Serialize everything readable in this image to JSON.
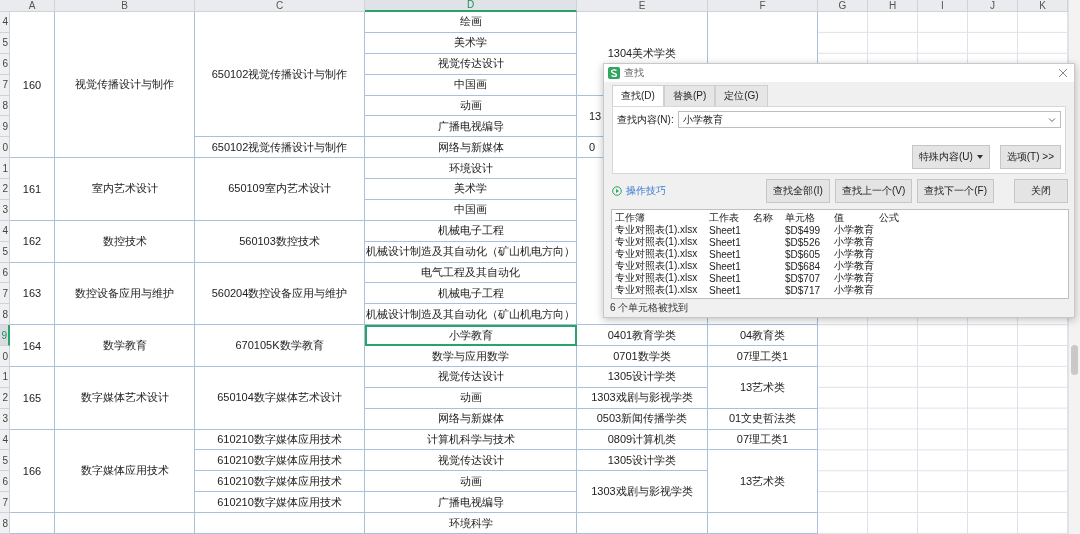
{
  "sheet": {
    "columns": [
      {
        "label": "A",
        "selected": false
      },
      {
        "label": "B",
        "selected": false
      },
      {
        "label": "C",
        "selected": false
      },
      {
        "label": "D",
        "selected": true
      },
      {
        "label": "E",
        "selected": false
      },
      {
        "label": "F",
        "selected": false
      },
      {
        "label": "G",
        "selected": false
      },
      {
        "label": "H",
        "selected": false
      },
      {
        "label": "I",
        "selected": false
      },
      {
        "label": "J",
        "selected": false
      },
      {
        "label": "K",
        "selected": false
      }
    ],
    "rows": [
      {
        "number": "4",
        "selected": false,
        "a": {
          "text": "160"
        },
        "b": {
          "text": "视觉传播设计与制作"
        },
        "c": {
          "text": "650102视觉传播设计与制作"
        },
        "d": {
          "text": "绘画"
        },
        "e": {
          "text": "1304美术学类"
        },
        "f": {
          "kind": "blank"
        }
      },
      {
        "number": "5",
        "selected": false,
        "d": {
          "text": "美术学"
        }
      },
      {
        "number": "6",
        "selected": false,
        "d": {
          "text": "视觉传达设计"
        }
      },
      {
        "number": "7",
        "selected": false,
        "d": {
          "text": "中国画"
        }
      },
      {
        "number": "8",
        "selected": false,
        "d": {
          "text": "动画"
        },
        "e": {
          "text": "13",
          "kind": "cut"
        }
      },
      {
        "number": "9",
        "selected": false,
        "d": {
          "text": "广播电视编导"
        }
      },
      {
        "number": "0",
        "selected": false,
        "c": {
          "text": "650102视觉传播设计与制作"
        },
        "d": {
          "text": "网络与新媒体"
        },
        "e": {
          "text": "0",
          "kind": "cut"
        }
      },
      {
        "number": "1",
        "selected": false,
        "a": {
          "text": "161"
        },
        "b": {
          "text": "室内艺术设计"
        },
        "c": {
          "text": "650109室内艺术设计"
        },
        "d": {
          "text": "环境设计"
        },
        "e": {
          "kind": "blank"
        }
      },
      {
        "number": "2",
        "selected": false,
        "d": {
          "text": "美术学"
        }
      },
      {
        "number": "3",
        "selected": false,
        "d": {
          "text": "中国画"
        }
      },
      {
        "number": "4",
        "selected": false,
        "a": {
          "text": "162"
        },
        "b": {
          "text": "数控技术"
        },
        "c": {
          "text": "560103数控技术"
        },
        "d": {
          "text": "机械电子工程"
        }
      },
      {
        "number": "5",
        "selected": false,
        "d": {
          "text": "机械设计制造及其自动化（矿山机电方向）"
        }
      },
      {
        "number": "6",
        "selected": false,
        "a": {
          "text": "163"
        },
        "b": {
          "text": "数控设备应用与维护"
        },
        "c": {
          "text": "560204数控设备应用与维护"
        },
        "d": {
          "text": "电气工程及其自动化"
        }
      },
      {
        "number": "7",
        "selected": false,
        "d": {
          "text": "机械电子工程"
        }
      },
      {
        "number": "8",
        "selected": false,
        "d": {
          "text": "机械设计制造及其自动化（矿山机电方向）"
        }
      },
      {
        "number": "9",
        "selected": true,
        "a": {
          "text": "164"
        },
        "b": {
          "text": "数学教育"
        },
        "c": {
          "text": "670105K数学教育"
        },
        "d": {
          "text": "小学教育"
        },
        "e": {
          "text": "0401教育学类"
        },
        "f": {
          "text": "04教育类"
        }
      },
      {
        "number": "0",
        "selected": false,
        "d": {
          "text": "数学与应用数学"
        },
        "e": {
          "text": "0701数学类"
        },
        "f": {
          "text": "07理工类1"
        }
      },
      {
        "number": "1",
        "selected": false,
        "a": {
          "text": "165"
        },
        "b": {
          "text": "数字媒体艺术设计"
        },
        "c": {
          "text": "650104数字媒体艺术设计"
        },
        "d": {
          "text": "视觉传达设计"
        },
        "e": {
          "text": "1305设计学类"
        },
        "f": {
          "text": "13艺术类"
        }
      },
      {
        "number": "2",
        "selected": false,
        "d": {
          "text": "动画"
        },
        "e": {
          "text": "1303戏剧与影视学类"
        }
      },
      {
        "number": "3",
        "selected": false,
        "d": {
          "text": "网络与新媒体"
        },
        "e": {
          "text": "0503新闻传播学类"
        },
        "f": {
          "text": "01文史哲法类"
        }
      },
      {
        "number": "4",
        "selected": false,
        "a": {
          "text": "166"
        },
        "b": {
          "text": "数字媒体应用技术"
        },
        "c": {
          "text": "610210数字媒体应用技术"
        },
        "d": {
          "text": "计算机科学与技术"
        },
        "e": {
          "text": "0809计算机类"
        },
        "f": {
          "text": "07理工类1"
        }
      },
      {
        "number": "5",
        "selected": false,
        "c": {
          "text": "610210数字媒体应用技术"
        },
        "d": {
          "text": "视觉传达设计"
        },
        "e": {
          "text": "1305设计学类"
        },
        "f": {
          "text": "13艺术类"
        }
      },
      {
        "number": "6",
        "selected": false,
        "c": {
          "text": "610210数字媒体应用技术"
        },
        "d": {
          "text": "动画"
        },
        "e": {
          "text": "1303戏剧与影视学类"
        }
      },
      {
        "number": "7",
        "selected": false,
        "c": {
          "text": "610210数字媒体应用技术"
        },
        "d": {
          "text": "广播电视编导"
        }
      },
      {
        "number": "8",
        "selected": false,
        "a": {
          "kind": "blank"
        },
        "b": {
          "kind": "blank"
        },
        "c": {
          "kind": "blank"
        },
        "d": {
          "text": "环境科学"
        },
        "e": {
          "kind": "blank"
        },
        "f": {
          "kind": "blank"
        }
      }
    ]
  },
  "find_dialog": {
    "title": "查找",
    "tabs": [
      {
        "label": "查找(D)",
        "selected": true
      },
      {
        "label": "替换(P)",
        "selected": false
      },
      {
        "label": "定位(G)",
        "selected": false
      }
    ],
    "search_label": "查找内容(N):",
    "search_value": "小学教育",
    "special_button": "特殊内容(U)",
    "options_button": "选项(T) >>",
    "tips_link": "操作技巧",
    "buttons": [
      "查找全部(I)",
      "查找上一个(V)",
      "查找下一个(F)",
      "关闭"
    ],
    "results": {
      "columns": [
        "工作簿",
        "工作表",
        "名称",
        "单元格",
        "值",
        "公式"
      ],
      "rows": [
        {
          "workbook": "专业对照表(1).xlsx",
          "sheet": "Sheet1",
          "cell": "$D$499",
          "value": "小学教育"
        },
        {
          "workbook": "专业对照表(1).xlsx",
          "sheet": "Sheet1",
          "cell": "$D$526",
          "value": "小学教育"
        },
        {
          "workbook": "专业对照表(1).xlsx",
          "sheet": "Sheet1",
          "cell": "$D$605",
          "value": "小学教育"
        },
        {
          "workbook": "专业对照表(1).xlsx",
          "sheet": "Sheet1",
          "cell": "$D$684",
          "value": "小学教育"
        },
        {
          "workbook": "专业对照表(1).xlsx",
          "sheet": "Sheet1",
          "cell": "$D$707",
          "value": "小学教育"
        },
        {
          "workbook": "专业对照表(1).xlsx",
          "sheet": "Sheet1",
          "cell": "$D$717",
          "value": "小学教育"
        }
      ]
    },
    "status": "6 个单元格被找到"
  }
}
